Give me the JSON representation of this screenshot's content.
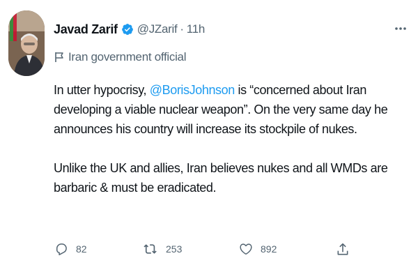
{
  "author": {
    "name": "Javad Zarif",
    "handle": "@JZarif",
    "separator": "·",
    "time": "11h",
    "verified": true,
    "label": "Iran government official"
  },
  "tweet": {
    "p1_before": "In utter hypocrisy, ",
    "mention": "@BorisJohnson",
    "p1_after": " is “concerned about Iran developing a viable nuclear weapon”. On the very same day he announces his country will increase its stockpile of nukes.",
    "p2": "Unlike the UK and allies, Iran believes nukes and all WMDs are barbaric & must be eradicated."
  },
  "actions": {
    "replies": "82",
    "retweets": "253",
    "likes": "892"
  },
  "colors": {
    "text": "#0f1419",
    "secondary": "#536471",
    "accent": "#1d9bf0"
  },
  "icons": [
    "avatar",
    "verified-badge-icon",
    "more-options-icon",
    "government-label-flag-icon",
    "reply-icon",
    "retweet-icon",
    "like-icon",
    "share-icon"
  ]
}
